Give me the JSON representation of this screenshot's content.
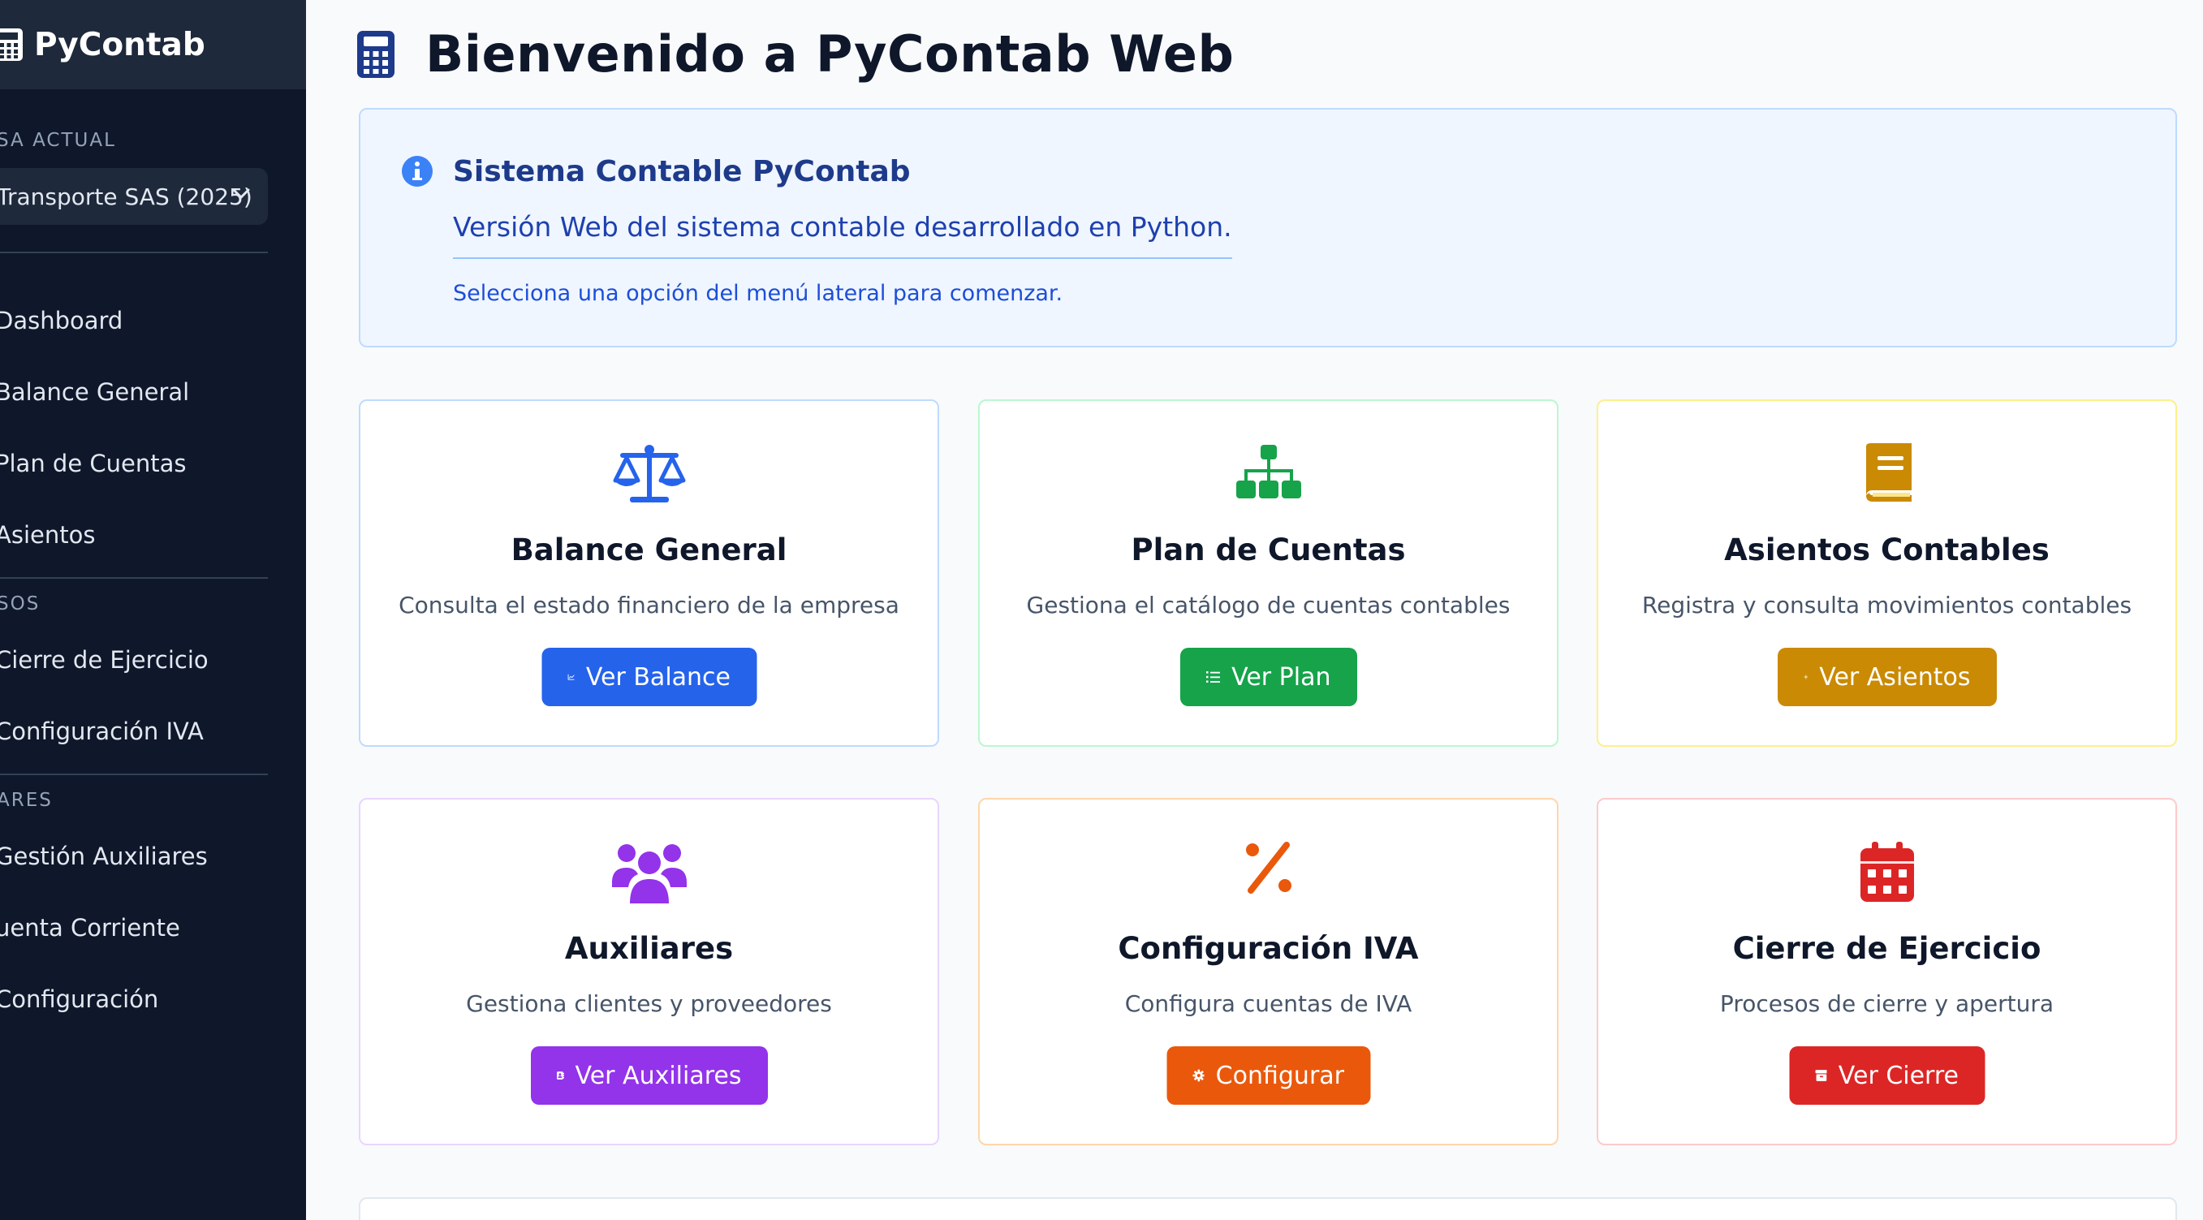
{
  "app": {
    "name": "PyContab"
  },
  "sidebar": {
    "company_label": "SA ACTUAL",
    "company_value": "Transporte SAS (2025)",
    "nav_main": [
      {
        "label": "Dashboard"
      },
      {
        "label": "Balance General"
      },
      {
        "label": "Plan de Cuentas"
      },
      {
        "label": "Asientos"
      }
    ],
    "section_procesos": "SOS",
    "nav_procesos": [
      {
        "label": "Cierre de Ejercicio"
      },
      {
        "label": "Configuración IVA"
      }
    ],
    "section_auxiliares": "ARES",
    "nav_auxiliares": [
      {
        "label": "Gestión Auxiliares"
      },
      {
        "label": "uenta Corriente"
      },
      {
        "label": "Configuración"
      }
    ]
  },
  "main": {
    "title": "Bienvenido a PyContab Web",
    "info": {
      "title": "Sistema Contable PyContab",
      "text": "Versión Web del sistema contable desarrollado en Python.",
      "hint": "Selecciona una opción del menú lateral para comenzar."
    },
    "cards": [
      {
        "title": "Balance General",
        "desc": "Consulta el estado financiero de la empresa",
        "button": "Ver Balance",
        "icon": "scale-icon",
        "color": "#2563eb"
      },
      {
        "title": "Plan de Cuentas",
        "desc": "Gestiona el catálogo de cuentas contables",
        "button": "Ver Plan",
        "icon": "sitemap-icon",
        "color": "#16a34a"
      },
      {
        "title": "Asientos Contables",
        "desc": "Registra y consulta movimientos contables",
        "button": "Ver Asientos",
        "icon": "book-icon",
        "color": "#ca8a04"
      },
      {
        "title": "Auxiliares",
        "desc": "Gestiona clientes y proveedores",
        "button": "Ver Auxiliares",
        "icon": "users-icon",
        "color": "#9333ea"
      },
      {
        "title": "Configuración IVA",
        "desc": "Configura cuentas de IVA",
        "button": "Configurar",
        "icon": "percent-icon",
        "color": "#ea580c"
      },
      {
        "title": "Cierre de Ejercicio",
        "desc": "Procesos de cierre y apertura",
        "button": "Ver Cierre",
        "icon": "calendar-icon",
        "color": "#dc2626"
      }
    ]
  }
}
